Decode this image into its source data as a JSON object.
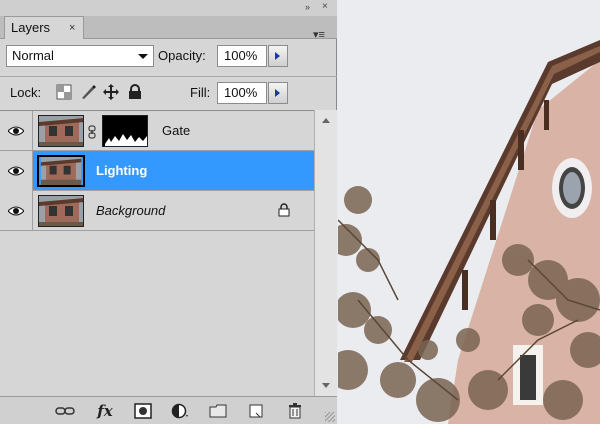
{
  "panel": {
    "tab_label": "Layers",
    "tab_close": "×",
    "collapse_glyph": "»",
    "close_glyph": "×",
    "menu_glyph": "▾≡"
  },
  "blend_mode": {
    "selected": "Normal"
  },
  "opacity": {
    "label": "Opacity:",
    "value": "100%"
  },
  "lock": {
    "label": "Lock:",
    "icons": [
      "lock-transparent-icon",
      "lock-image-icon",
      "lock-position-icon",
      "lock-all-icon"
    ]
  },
  "fill": {
    "label": "Fill:",
    "value": "100%"
  },
  "layers": [
    {
      "name": "Gate",
      "visible": true,
      "selected": false,
      "has_mask": true,
      "locked": false
    },
    {
      "name": "Lighting",
      "visible": true,
      "selected": true,
      "has_mask": false,
      "locked": false
    },
    {
      "name": "Background",
      "visible": true,
      "selected": false,
      "has_mask": false,
      "locked": true
    }
  ],
  "bottom_icons": [
    "link-layers-icon",
    "fx-icon",
    "add-mask-icon",
    "adjustment-layer-icon",
    "new-group-icon",
    "new-layer-icon",
    "trash-icon"
  ],
  "fx_label": "fx",
  "colors": {
    "selection": "#3399ff",
    "panel": "#d6d6d6"
  }
}
